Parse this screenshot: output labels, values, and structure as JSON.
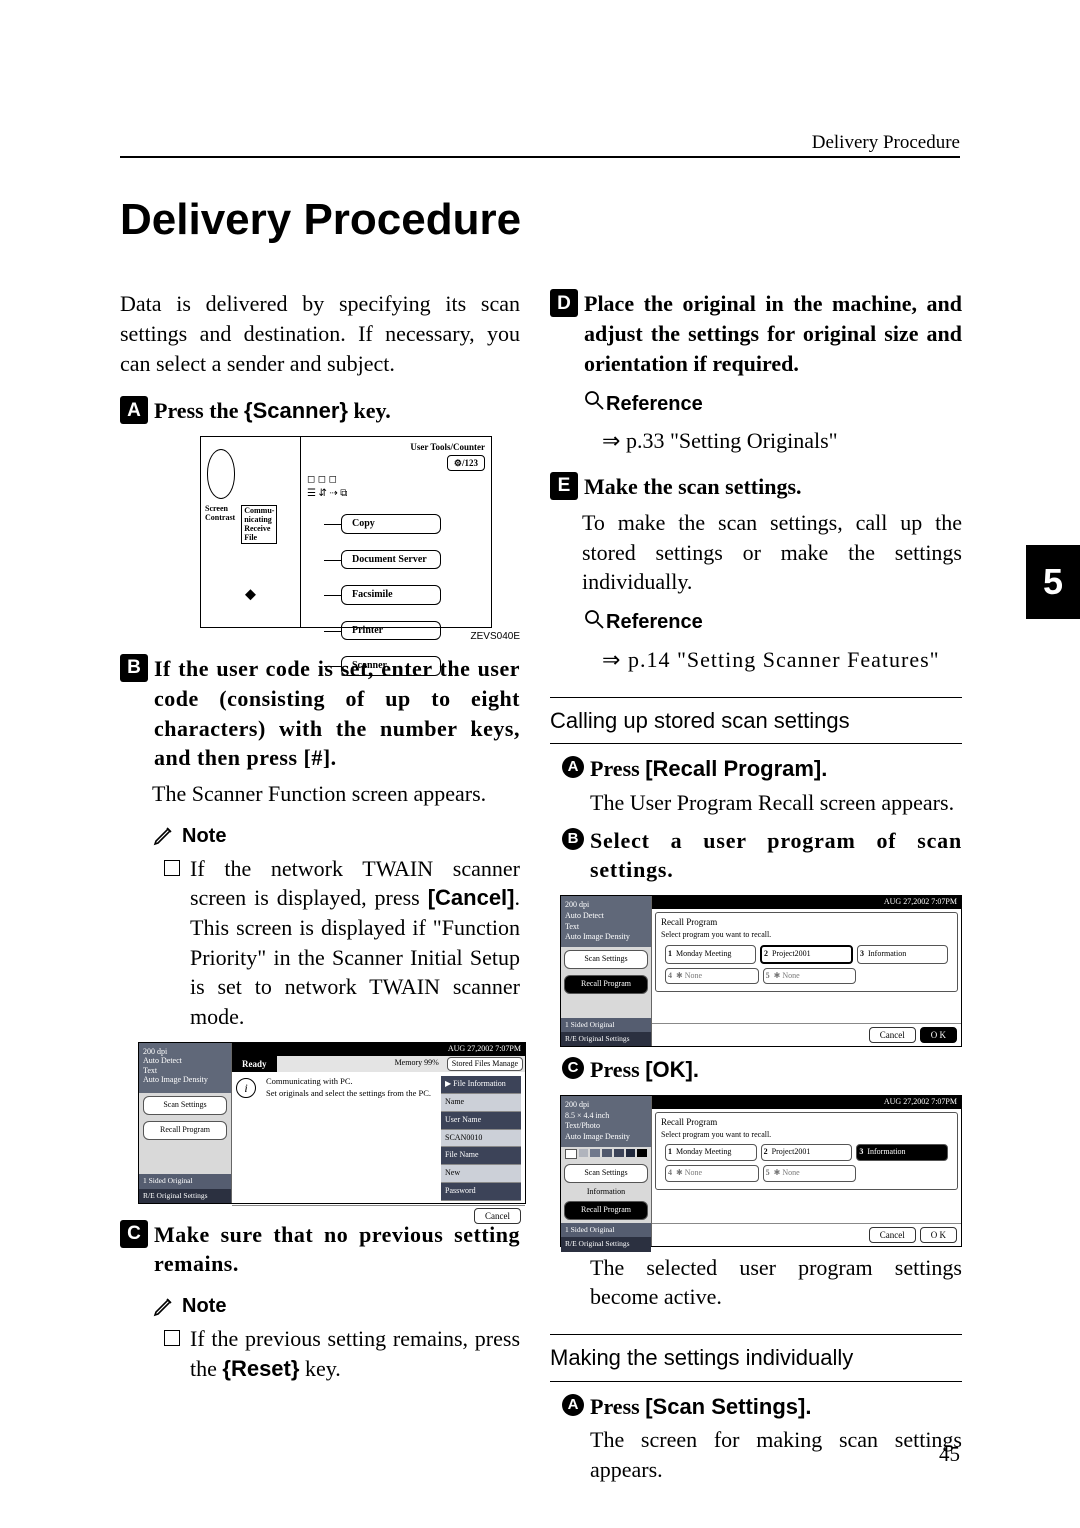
{
  "running_head": "Delivery Procedure",
  "page_title": "Delivery Procedure",
  "chapter_tab": "5",
  "page_number": "45",
  "intro": "Data is delivered by specifying its scan settings and destination. If necessary, you can select a sender and subject.",
  "left": {
    "step1": {
      "num": "A",
      "text_pre": "Press the ",
      "keycap": "{Scanner}",
      "text_post": " key."
    },
    "fig1": {
      "top_label": "User Tools/Counter",
      "small_btn": "⚙/123",
      "left_labels": [
        "Screen",
        "Contrast"
      ],
      "left_sub": [
        "Commu-",
        "nicating",
        "Receive",
        "File"
      ],
      "iconrow": "◻ ◻ ◻\n☰ ⇵ ⇢ ⧉",
      "modes": [
        "Copy",
        "Document Server",
        "Facsimile",
        "Printer",
        "Scanner"
      ],
      "code": "ZEVS040E"
    },
    "step2": {
      "num": "B",
      "text": "If the user code is set, enter the user code (consisting of up to eight characters) with the number keys, and then press [#]."
    },
    "step2_body": "The Scanner Function screen appears.",
    "note1_head": "Note",
    "note1_body_pre": "If the network TWAIN scanner screen is displayed, press ",
    "note1_bold": "[Cancel]",
    "note1_body_post": ". This screen is displayed if \"Function Priority\" in the Scanner Initial Setup is set to network TWAIN scanner mode.",
    "fig2": {
      "time": "AUG  27,2002  7:07PM",
      "sb_info": "200 dpi\nAuto Detect\nText\nAuto Image Density",
      "sb_btns": [
        "Scan Settings",
        "Recall Program"
      ],
      "sb_strip": [
        "1 Sided Original",
        "R/E Original Settings"
      ],
      "ready": "Ready",
      "memory": "Memory 99%",
      "stored": "Stored Files Manage",
      "msg1": "Communicating with PC.",
      "msg2": "Set originals and select the settings from the PC.",
      "right_rows": [
        "▶ File Information",
        "Name",
        "User Name",
        "SCAN0010",
        "File Name",
        "New",
        "Password"
      ],
      "cancel": "Cancel"
    },
    "step3": {
      "num": "C",
      "text": "Make sure that no previous setting remains."
    },
    "note2_head": "Note",
    "note2_body": "If the previous setting remains, press the ",
    "note2_key": "{Reset}",
    "note2_body2": " key."
  },
  "right": {
    "step4": {
      "num": "D",
      "text": "Place the original in the machine, and adjust the settings for original size and orientation if required."
    },
    "ref1_head": "Reference",
    "ref1_body": "p.33 \"Setting Originals\"",
    "step5": {
      "num": "E",
      "text": "Make the scan settings."
    },
    "step5_body": "To make the scan settings, call up the stored settings or make the settings individually.",
    "ref2_head": "Reference",
    "ref2_body": "p.14 \"Setting Scanner Features\"",
    "sub1_head": "Calling up stored scan settings",
    "sub1_s1": {
      "n": "A",
      "text": "Press ",
      "bold": "[Recall Program]."
    },
    "sub1_s1_body": "The User Program Recall screen appears.",
    "sub1_s2": {
      "n": "B",
      "text": "Select a user program of scan settings."
    },
    "fig3": {
      "time": "AUG  27,2002  7:07PM",
      "sb_info": "200 dpi\nAuto Detect\nText\nAuto Image Density",
      "sb_btns": [
        "Scan Settings",
        "Recall Program"
      ],
      "sb_strip": [
        "1 Sided Original",
        "R/E Original Settings"
      ],
      "titlebar": "Recall Program",
      "hint": "Select program you want to recall.",
      "slots_r1": [
        {
          "n": "1",
          "label": "Monday Meeting"
        },
        {
          "n": "2",
          "label": "Project2001"
        },
        {
          "n": "3",
          "label": "Information"
        }
      ],
      "slots_r2": [
        {
          "n": "4",
          "label": "✱ None"
        },
        {
          "n": "5",
          "label": "✱ None"
        }
      ],
      "cancel": "Cancel",
      "ok": "O K"
    },
    "sub1_s3": {
      "n": "C",
      "text": "Press ",
      "bold": "[OK]."
    },
    "fig4": {
      "time": "AUG  27,2002  7:07PM",
      "sb_info": "200 dpi\n8.5 × 4.4 inch\nText/Photo\nAuto Image Density",
      "sb_btns": [
        "Scan Settings",
        "Recall Program"
      ],
      "sb_extra": "Information",
      "sb_strip": [
        "1 Sided Original",
        "R/E Original Settings"
      ],
      "titlebar": "Recall Program",
      "hint": "Select program you want to recall.",
      "slots_r1": [
        {
          "n": "1",
          "label": "Monday Meeting"
        },
        {
          "n": "2",
          "label": "Project2001"
        },
        {
          "n": "3",
          "label": "Information"
        }
      ],
      "slots_r2": [
        {
          "n": "4",
          "label": "✱ None"
        },
        {
          "n": "5",
          "label": "✱ None"
        }
      ],
      "cancel": "Cancel",
      "ok": "O K"
    },
    "sub1_s3_body": "The selected user program settings become active.",
    "sub2_head": "Making the settings individually",
    "sub2_s1": {
      "n": "A",
      "text": "Press ",
      "bold": "[Scan Settings]."
    },
    "sub2_s1_body": "The screen for making scan settings appears."
  }
}
